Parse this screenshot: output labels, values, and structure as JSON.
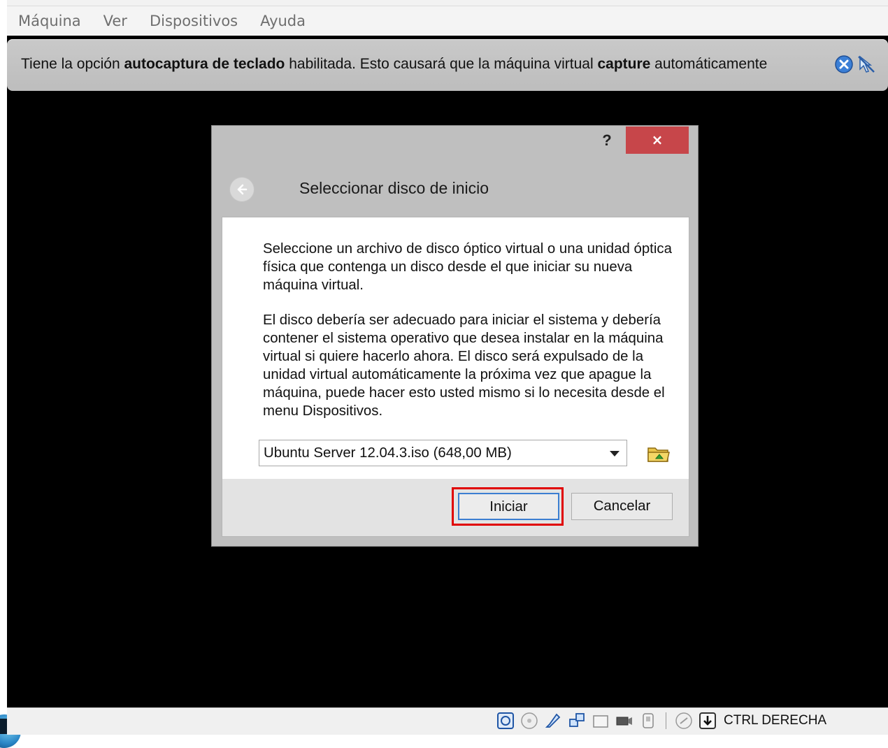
{
  "menu": {
    "items": [
      "Máquina",
      "Ver",
      "Dispositivos",
      "Ayuda"
    ]
  },
  "notice": {
    "part1": "Tiene la opción ",
    "bold1": "autocaptura de teclado",
    "part2": " habilitada. Esto causará que la máquina virtual ",
    "bold2": "capture",
    "part3": " automáticamente",
    "icons": [
      "close-notice-icon",
      "mouse-integration-icon"
    ]
  },
  "dialog": {
    "help_label": "?",
    "close_label": "×",
    "title": "Seleccionar disco de inicio",
    "paragraph1": "Seleccione un archivo de disco óptico virtual o una unidad óptica física que contenga un disco desde el que iniciar su nueva máquina virtual.",
    "paragraph2": "El disco debería ser adecuado para iniciar el sistema y debería contener el sistema operativo que desea instalar en la máquina virtual si quiere hacerlo ahora. El disco será expulsado de la unidad virtual automáticamente la próxima vez que apague la máquina, puede hacer esto usted mismo si lo necesita desde el menu Dispositivos.",
    "disk_select": {
      "value": "Ubuntu Server 12.04.3.iso (648,00 MB)"
    },
    "buttons": {
      "start": "Iniciar",
      "cancel": "Cancelar"
    }
  },
  "statusbar": {
    "host_key": "CTRL DERECHA",
    "icons": [
      "hard-disk-icon",
      "optical-drive-icon",
      "usb-icon",
      "network-icon",
      "shared-folders-icon",
      "video-capture-icon",
      "mouse-icon",
      "keyboard-capture-icon",
      "host-key-icon"
    ]
  },
  "colors": {
    "close_button": "#c7464a",
    "highlight": "#e00000",
    "vm_background": "#000000"
  }
}
